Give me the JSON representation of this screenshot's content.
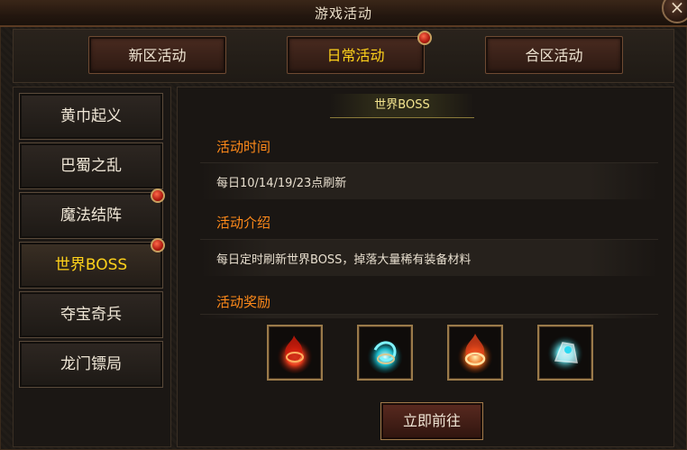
{
  "window": {
    "title": "游戏活动",
    "close": "×"
  },
  "tabs": [
    {
      "label": "新区活动",
      "active": false
    },
    {
      "label": "日常活动",
      "active": true,
      "badge": true
    },
    {
      "label": "合区活动",
      "active": false
    }
  ],
  "sidebar": {
    "items": [
      {
        "label": "黄巾起义",
        "active": false
      },
      {
        "label": "巴蜀之乱",
        "active": false
      },
      {
        "label": "魔法结阵",
        "active": false,
        "badge": true
      },
      {
        "label": "世界BOSS",
        "active": true,
        "badge": true
      },
      {
        "label": "夺宝奇兵",
        "active": false
      },
      {
        "label": "龙门镖局",
        "active": false
      }
    ]
  },
  "detail": {
    "banner": "世界BOSS",
    "time_title": "活动时间",
    "time_text": "每日10/14/19/23点刷新",
    "intro_title": "活动介绍",
    "intro_text": "每日定时刷新世界BOSS，掉落大量稀有装备材料",
    "reward_title": "活动奖励",
    "rewards": [
      {
        "icon": "red-flame-ring-icon"
      },
      {
        "icon": "blue-swirl-ring-icon"
      },
      {
        "icon": "orange-fire-ring-icon"
      },
      {
        "icon": "cyan-gem-bracer-icon"
      }
    ],
    "go_button": "立即前往"
  },
  "colors": {
    "accent_yellow": "#ffd21a",
    "section_orange": "#ff8a1a",
    "badge_red": "#d0281a"
  }
}
